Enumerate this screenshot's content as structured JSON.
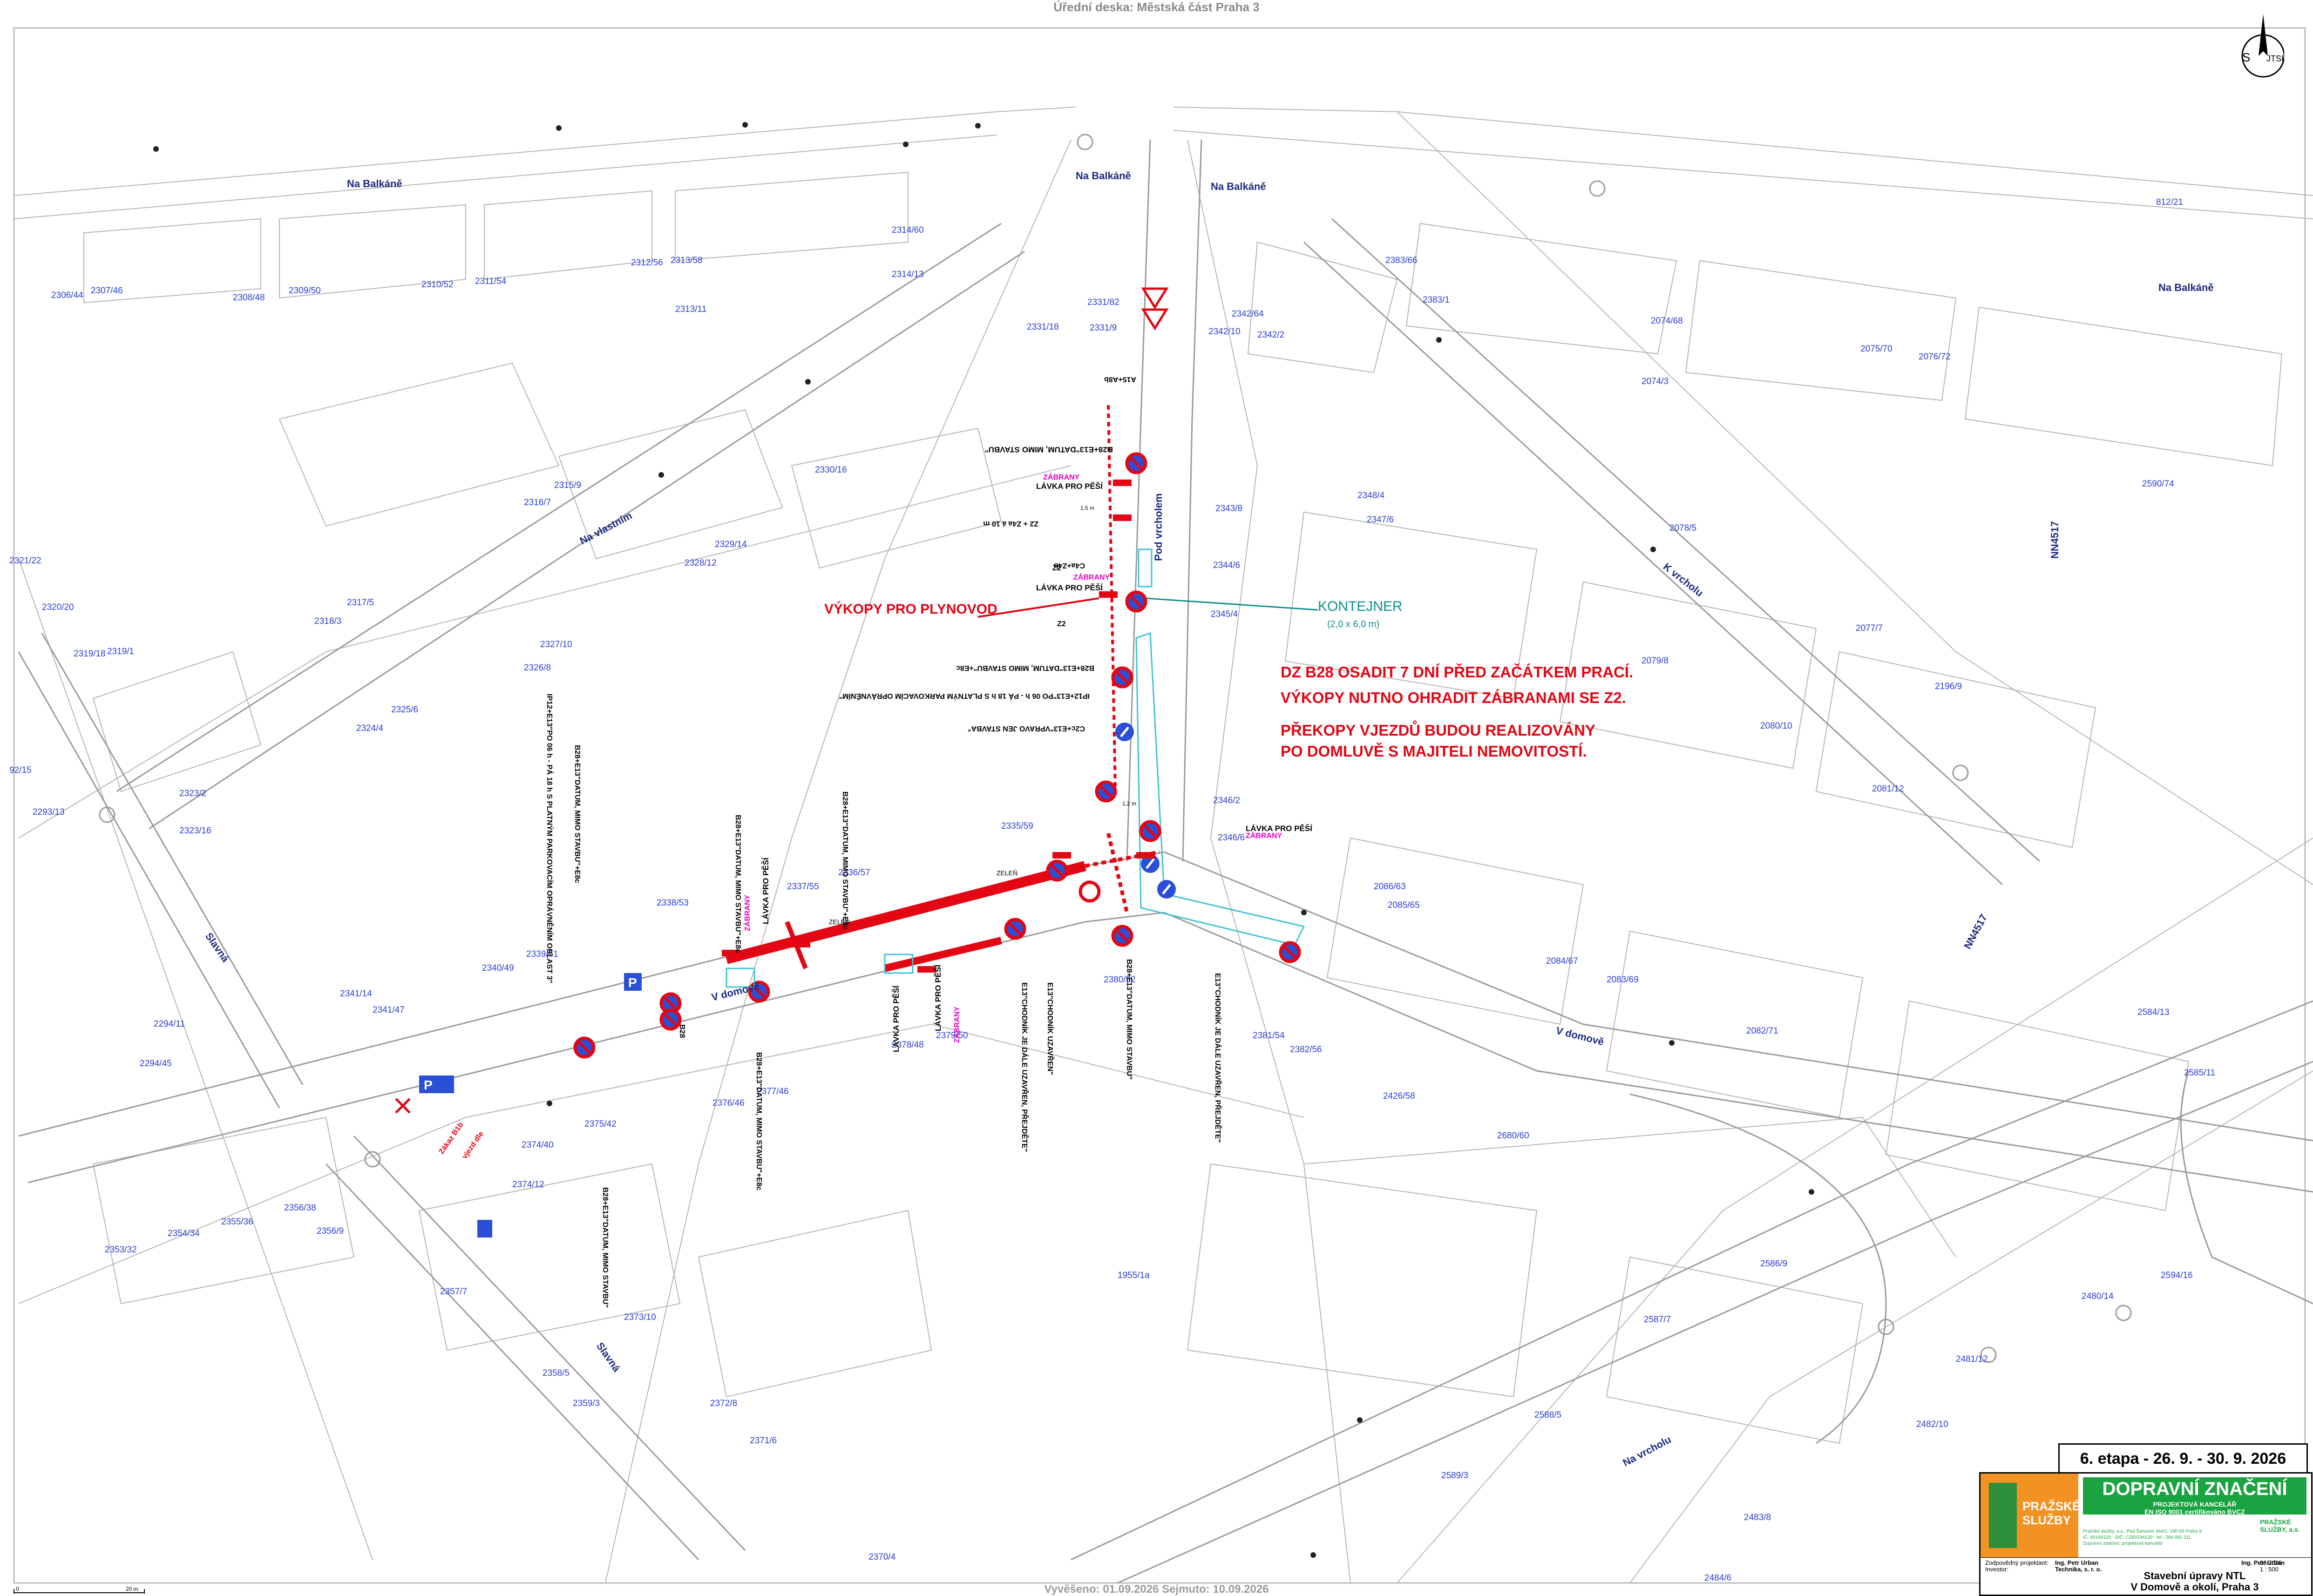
{
  "header_text": "Úřední deska: Městská část Praha 3",
  "footer_text": "Vyvěšeno: 01.09.2026     Sejmuto: 10.09.2026",
  "north_arrow": {
    "letter": "S",
    "label": "JTSK"
  },
  "streets": [
    {
      "id": "na-balkane-1",
      "text": "Na Balkáně"
    },
    {
      "id": "na-balkane-2",
      "text": "Na Balkáně"
    },
    {
      "id": "na-balkane-3",
      "text": "Na Balkáně"
    },
    {
      "id": "na-balkane-4",
      "text": "Na Balkáně"
    },
    {
      "id": "na-vlastnim",
      "text": "Na vlastním"
    },
    {
      "id": "pod-vrcholem",
      "text": "Pod vrcholem"
    },
    {
      "id": "k-vrcholu",
      "text": "K vrcholu"
    },
    {
      "id": "v-domove-1",
      "text": "V domově"
    },
    {
      "id": "v-domove-2",
      "text": "V domově"
    },
    {
      "id": "sluzna-1",
      "text": "Slavná"
    },
    {
      "id": "sluzna-2",
      "text": "Slavná"
    },
    {
      "id": "na-vrcholu",
      "text": "Na vrcholu"
    },
    {
      "id": "nn4517-1",
      "text": "NN4517"
    },
    {
      "id": "nn4517-2",
      "text": "NN4517"
    }
  ],
  "parcels": [
    "2314/60",
    "2314/13",
    "2306/44",
    "2307/46",
    "2308/48",
    "2309/50",
    "2310/52",
    "2311/54",
    "2312/56",
    "2313/58",
    "2313/11",
    "2331/82",
    "2331/9",
    "2331/18",
    "2342/64",
    "2342/10",
    "2342/2",
    "2383/66",
    "2383/1",
    "812/21",
    "2074/68",
    "2075/70",
    "2076/72",
    "2074/3",
    "2330/16",
    "2315/9",
    "2316/7",
    "2329/14",
    "2328/12",
    "2343/8",
    "2344/6",
    "2345/4",
    "2348/4",
    "2347/6",
    "2078/5",
    "2590/74",
    "2321/22",
    "2320/20",
    "2319/18",
    "2319/1",
    "2317/5",
    "2318/3",
    "2327/10",
    "2326/8",
    "2077/7",
    "2079/8",
    "2196/9",
    "2325/6",
    "2324/4",
    "2080/10",
    "2323/2",
    "2323/16",
    "2081/12",
    "2293/13",
    "92/15",
    "2338/53",
    "2337/55",
    "2336/57",
    "2335/59",
    "2346/2",
    "2346/6",
    "2086/63",
    "2085/65",
    "2339/51",
    "2340/49",
    "2341/14",
    "2341/47",
    "2294/11",
    "2294/45",
    "2378/48",
    "2379/50",
    "2380/52",
    "2381/54",
    "2382/56",
    "2084/67",
    "2083/69",
    "2082/71",
    "2584/13",
    "2585/11",
    "2376/46",
    "2377/46",
    "2375/42",
    "2374/40",
    "2374/12",
    "2426/58",
    "2680/60",
    "2356/38",
    "2356/9",
    "2354/34",
    "2355/36",
    "2353/32",
    "2357/7",
    "2373/10",
    "1955/1a",
    "2586/9",
    "2594/16",
    "2480/14",
    "2587/7",
    "2481/12",
    "2358/5",
    "2359/3",
    "2372/8",
    "2371/6",
    "2588/5",
    "2482/10",
    "2589/3",
    "2483/8",
    "2370/4",
    "2484/6"
  ],
  "annotations": {
    "vykopy": "VÝKOPY PRO PLYNOVOD",
    "kontejner": "KONTEJNER",
    "kontejner_size": "(2,0 x 6,0 m)",
    "notice": [
      "DZ B28 OSADIT 7 DNÍ PŘED ZAČÁTKEM PRACÍ.",
      "VÝKOPY NUTNO OHRADIT ZÁBRANAMI SE Z2.",
      "PŘEKOPY VJEZDŮ BUDOU REALIZOVÁNY",
      "PO DOMLUVĚ S MAJITELI NEMOVITOSTÍ."
    ],
    "zabrany": "ZÁBRANY",
    "lavka": "LÁVKA PRO PĚŠÍ",
    "z2": "Z2",
    "zeleň": "ZELEŇ",
    "sign_b28_1": "B28+E13\"DATUM, MIMO STAVBU\"",
    "sign_b28_2": "B28+E13\"DATUM, MIMO STAVBU\"+E8c",
    "sign_c4a": "C4a+Z4b",
    "sign_z2_zaba": "Z2 + Z4a á 10 m",
    "sign_a15": "A15+A8b",
    "sign_ip12": "IP12+E13\"PO 06 h - PÁ 18 h S PLATNÝM PARKOVACÍM OPRÁVNĚNÍM\"",
    "sign_c2c": "C2c+E13\"VPRAVO JEN STAVBA\"",
    "sign_e13_chodnik": "E13\"CHODNÍK UZAVŘEN\"",
    "sign_e13_prejdete": "E13\"CHODNÍK JE DÁLE UZAVŘEN, PŘEJDĚTE\"",
    "sign_b28_left_1": "IP12+E13\"PO 06 h - PÁ 18 h S PLATNÝM PARKOVACÍM OPRÁVNĚNÍM OBLAST 3\"",
    "sign_b28_left_2": "B28+E13\"DATUM, MIMO STAVBU\"+E8c",
    "b28": "B28",
    "zakaz_bila": "Zákaz B1b",
    "vjezd_dle": "vjezd dle",
    "dim_15m": "1,5 m",
    "dim_12m": "1,2 m"
  },
  "stage_label": "6. etapa - 26. 9. - 30. 9. 2026",
  "title_block": {
    "logo_ps": [
      "PRAŽSKÉ",
      "SLUŽBY"
    ],
    "company_main": "DOPRAVNÍ ZNAČENÍ",
    "company_sub": "PROJEKTOVÁ KANCELÁŘ",
    "company_cert": "EN ISO 9001 certifikováno BVCZ",
    "ps_small": "PRAŽSKÉ SLUŽBY, a.s.",
    "contact_line1": "Pražské služby, a.s., Pod Šancemi 444/1, 190 00 Praha 9",
    "contact_line2": "IČ: 60194120 · DIČ: CZ60194120 · tel.: 284 091 111",
    "contact_line3": "Dopravní značení, projektová kancelář",
    "responsible_label": "Zodpovědný projektant:",
    "responsible": "Ing. Petr Urban",
    "investor_label": "Investor:",
    "investor": "Technika, s. r. o.",
    "designed": "Ing. Petr Urban",
    "date": "08/2026",
    "scale": "1 : 500",
    "title_line1": "Stavební úpravy NTL",
    "title_line2": "V Domově a okolí, Praha 3"
  },
  "scale_bar": {
    "start": "0",
    "end": "20 m"
  }
}
